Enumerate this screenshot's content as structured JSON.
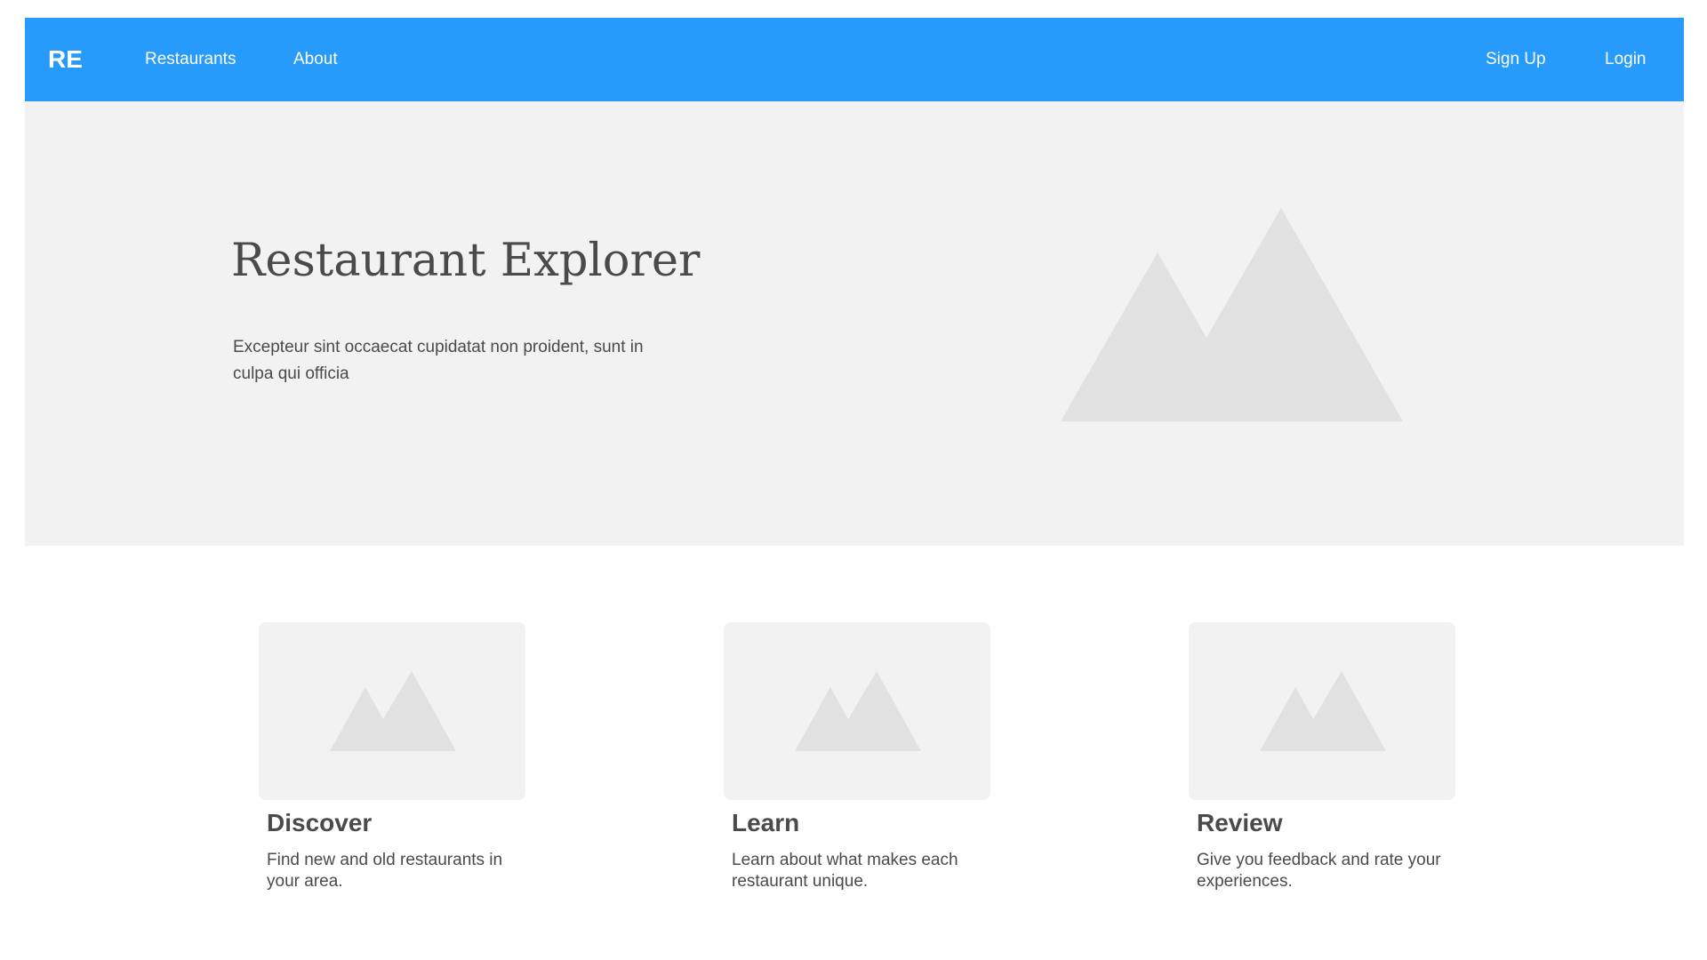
{
  "header": {
    "logo": "RE",
    "nav_left": [
      "Restaurants",
      "About"
    ],
    "nav_right": [
      "Sign Up",
      "Login"
    ]
  },
  "hero": {
    "title": "Restaurant Explorer",
    "text": "Excepteur sint occaecat cupidatat non proident, sunt in culpa qui officia",
    "image_icon": "mountain-image-placeholder-icon"
  },
  "features": [
    {
      "title": "Discover",
      "text": "Find new and old restaurants in your area.",
      "icon": "mountain-image-placeholder-icon"
    },
    {
      "title": "Learn",
      "text": "Learn about what makes each restaurant unique.",
      "icon": "mountain-image-placeholder-icon"
    },
    {
      "title": "Review",
      "text": "Give you feedback and rate your experiences.",
      "icon": "mountain-image-placeholder-icon"
    }
  ],
  "colors": {
    "nav_background": "#279bfb",
    "hero_background": "#f2f2f2",
    "placeholder_shape": "#e1e1e1",
    "text": "#4a4a4a"
  }
}
